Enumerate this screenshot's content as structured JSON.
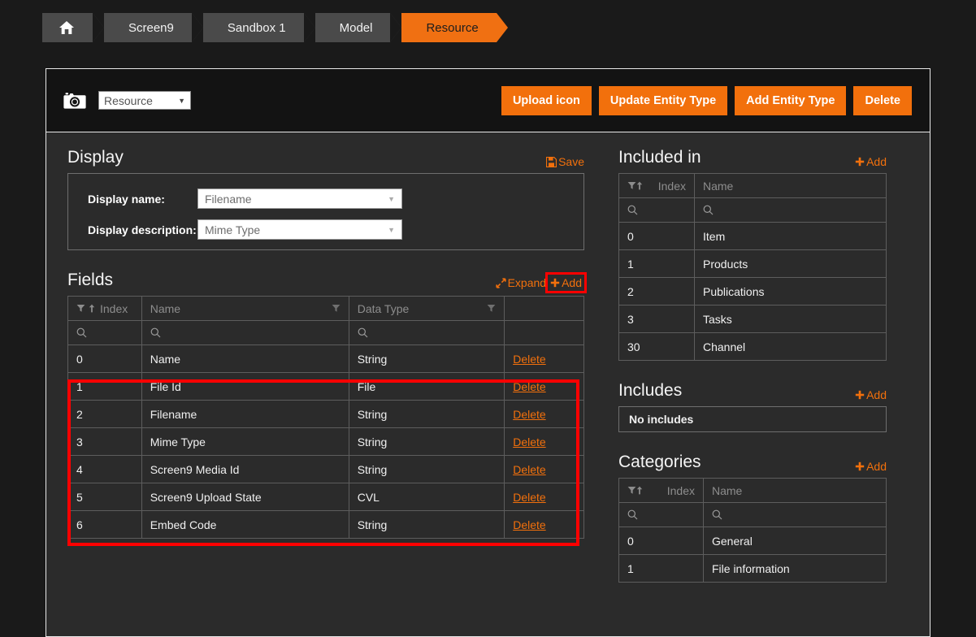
{
  "breadcrumb": {
    "items": [
      {
        "label": "",
        "icon": "home-icon",
        "active": false
      },
      {
        "label": "Screen9",
        "active": false
      },
      {
        "label": "Sandbox 1",
        "active": false
      },
      {
        "label": "Model",
        "active": false
      },
      {
        "label": "Resource",
        "active": true
      }
    ]
  },
  "header": {
    "icon": "camera-icon",
    "entity_select": {
      "value": "Resource"
    },
    "buttons": [
      {
        "label": "Upload icon",
        "name": "upload-icon-button"
      },
      {
        "label": "Update Entity Type",
        "name": "update-entity-type-button"
      },
      {
        "label": "Add Entity Type",
        "name": "add-entity-type-button"
      },
      {
        "label": "Delete",
        "name": "delete-entity-type-button"
      }
    ]
  },
  "display": {
    "title": "Display",
    "save_label": "Save",
    "name_label": "Display name:",
    "name_value": "Filename",
    "description_label": "Display description:",
    "description_value": "Mime Type"
  },
  "fields": {
    "title": "Fields",
    "expand_label": "Expand",
    "add_label": "Add",
    "columns": [
      "Index",
      "Name",
      "Data Type",
      ""
    ],
    "rows": [
      {
        "index": "0",
        "name": "Name",
        "type": "String",
        "action": "Delete"
      },
      {
        "index": "1",
        "name": "File Id",
        "type": "File",
        "action": "Delete"
      },
      {
        "index": "2",
        "name": "Filename",
        "type": "String",
        "action": "Delete"
      },
      {
        "index": "3",
        "name": "Mime Type",
        "type": "String",
        "action": "Delete"
      },
      {
        "index": "4",
        "name": "Screen9 Media Id",
        "type": "String",
        "action": "Delete"
      },
      {
        "index": "5",
        "name": "Screen9 Upload State",
        "type": "CVL",
        "action": "Delete"
      },
      {
        "index": "6",
        "name": "Embed Code",
        "type": "String",
        "action": "Delete"
      }
    ]
  },
  "included_in": {
    "title": "Included in",
    "add_label": "Add",
    "columns": [
      "Index",
      "Name"
    ],
    "rows": [
      {
        "index": "0",
        "name": "Item"
      },
      {
        "index": "1",
        "name": "Products"
      },
      {
        "index": "2",
        "name": "Publications"
      },
      {
        "index": "3",
        "name": "Tasks"
      },
      {
        "index": "30",
        "name": "Channel"
      }
    ]
  },
  "includes": {
    "title": "Includes",
    "add_label": "Add",
    "empty_text": "No includes"
  },
  "categories": {
    "title": "Categories",
    "add_label": "Add",
    "columns": [
      "Index",
      "Name"
    ],
    "rows": [
      {
        "index": "0",
        "name": "General"
      },
      {
        "index": "1",
        "name": "File information"
      }
    ]
  },
  "colors": {
    "accent": "#f2700c",
    "highlight": "#ff0000",
    "page_bg": "#1a1a1a",
    "panel_bg": "#2b2b2b"
  }
}
